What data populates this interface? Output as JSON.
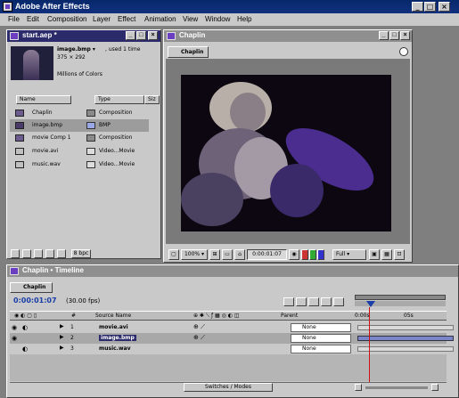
{
  "app": {
    "title": "Adobe After Effects",
    "window_buttons": [
      "_",
      "□",
      "×"
    ]
  },
  "menu": [
    "File",
    "Edit",
    "Composition",
    "Layer",
    "Effect",
    "Animation",
    "View",
    "Window",
    "Help"
  ],
  "project_panel": {
    "title": "start.aep *",
    "selected_name": "image.bmp ▾",
    "used_info": ", used 1 time",
    "dimensions": "375 × 292",
    "colors": "Millions of Colors",
    "columns": {
      "name": "Name",
      "type": "Type",
      "size": "Siz"
    },
    "items": [
      {
        "name": "Chaplin",
        "type": "Composition",
        "selected": false
      },
      {
        "name": "image.bmp",
        "type": "BMP",
        "selected": true
      },
      {
        "name": "movie Comp 1",
        "type": "Composition",
        "selected": false
      },
      {
        "name": "movie.avi",
        "type": "Video...Movie",
        "selected": false
      },
      {
        "name": "music.wav",
        "type": "Video...Movie",
        "selected": false
      }
    ],
    "bpc_label": "8 bpc"
  },
  "comp_panel": {
    "window_title": "Chaplin",
    "tab_label": "Chaplin",
    "zoom": "100%",
    "timecode": "0:00:01:07",
    "resolution": "Full"
  },
  "timeline": {
    "window_title": "Chaplin • Timeline",
    "tab_label": "Chaplin",
    "timecode": "0:00:01:07",
    "fps": "(30.00 fps)",
    "col_source": "Source Name",
    "col_parent": "Parent",
    "ruler_start": "0:00s",
    "ruler_mark": "05s",
    "switches_label": "Switches / Modes",
    "layers": [
      {
        "num": "1",
        "name": "movie.avi",
        "parent": "None",
        "selected": false
      },
      {
        "num": "2",
        "name": "image.bmp",
        "parent": "None",
        "selected": true
      },
      {
        "num": "3",
        "name": "music.wav",
        "parent": "None",
        "selected": false
      }
    ]
  },
  "colors": {
    "titlebar": "#10307e",
    "panel": "#c9c9c9",
    "purple_accent": "#6b3fbf",
    "timecode_blue": "#1a3ea8",
    "playhead": "#d01010"
  }
}
